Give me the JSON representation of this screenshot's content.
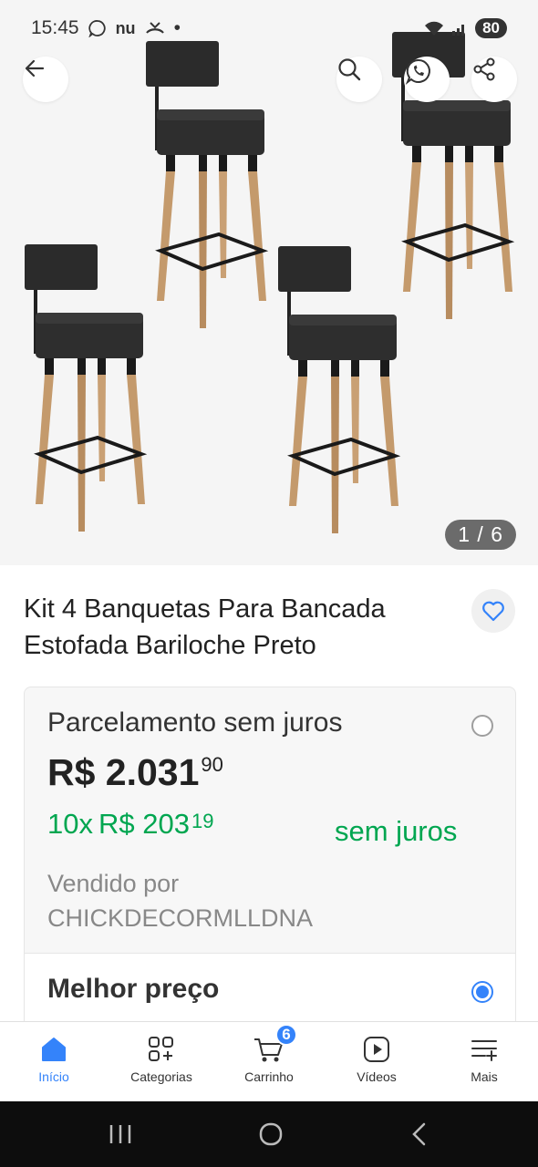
{
  "status_bar": {
    "time": "15:45",
    "notification_icons": [
      "whatsapp-icon",
      "nubank-icon",
      "missed-call-icon",
      "dot-icon"
    ],
    "battery": "80"
  },
  "gallery": {
    "page_counter": "1 / 6",
    "current_image": 1,
    "total_images": 6,
    "product_image": "four-bar-stools-image"
  },
  "product": {
    "title": "Kit 4 Banquetas Para Bancada Estofada Bariloche Preto"
  },
  "pricing": {
    "option_label": "Parcelamento sem juros",
    "price_main": "R$ 2.031",
    "price_cents": "90",
    "installment_count": "10x",
    "installment_main": "R$ 203",
    "installment_cents": "19",
    "no_interest": "sem juros",
    "sold_by_label": "Vendido por",
    "seller": "CHICKDECORMLLDNA",
    "best_price_label": "Melhor preço"
  },
  "bottom_nav": {
    "items": [
      {
        "label": "Início",
        "icon": "home-icon"
      },
      {
        "label": "Categorias",
        "icon": "categories-icon"
      },
      {
        "label": "Carrinho",
        "icon": "cart-icon",
        "badge": "6"
      },
      {
        "label": "Vídeos",
        "icon": "video-icon"
      },
      {
        "label": "Mais",
        "icon": "more-icon"
      }
    ]
  },
  "colors": {
    "accent": "#3483fa",
    "green": "#00a650",
    "gallery_bg": "#f5f5f5"
  }
}
